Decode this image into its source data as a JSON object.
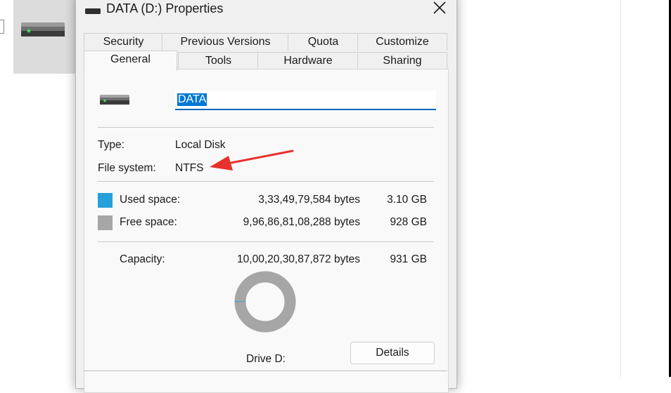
{
  "window": {
    "title": "DATA (D:) Properties",
    "close_icon": "close-icon"
  },
  "tabs_row1": [
    {
      "label": "Security"
    },
    {
      "label": "Previous Versions"
    },
    {
      "label": "Quota"
    },
    {
      "label": "Customize"
    }
  ],
  "tabs_row2": [
    {
      "label": "General",
      "active": true
    },
    {
      "label": "Tools"
    },
    {
      "label": "Hardware"
    },
    {
      "label": "Sharing"
    }
  ],
  "general": {
    "drive_name": "DATA",
    "type_label": "Type:",
    "type_value": "Local Disk",
    "fs_label": "File system:",
    "fs_value": "NTFS",
    "used": {
      "label": "Used space:",
      "bytes": "3,33,49,79,584 bytes",
      "size": "3.10 GB",
      "color": "#26a0da"
    },
    "free": {
      "label": "Free space:",
      "bytes": "9,96,86,81,08,288 bytes",
      "size": "928 GB",
      "color": "#a6a6a6"
    },
    "capacity": {
      "label": "Capacity:",
      "bytes": "10,00,20,30,87,872 bytes",
      "size": "931 GB"
    },
    "used_fraction": 0.0033,
    "drive_caption": "Drive D:",
    "details_label": "Details"
  },
  "annotation": {
    "color": "#e8302c"
  }
}
